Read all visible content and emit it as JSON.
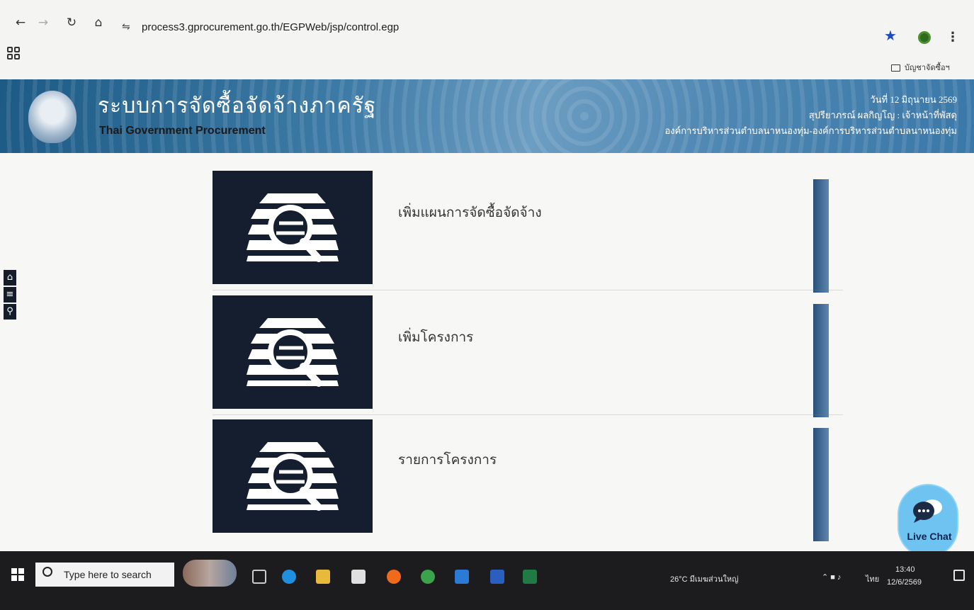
{
  "browser": {
    "url": "process3.gprocurement.go.th/EGPWeb/jsp/control.egp",
    "bookmark_folder": "บัญชาจัดซื้อฯ",
    "back_icon": "back-arrow-icon",
    "forward_icon": "forward-arrow-icon",
    "reload_icon": "reload-icon",
    "home_icon": "home-icon"
  },
  "header": {
    "title_th": "ระบบการจัดซื้อจัดจ้างภาครัฐ",
    "title_en": "Thai Government Procurement",
    "date": "วันที่ 12 มิถุนายน 2569",
    "user": "สุปรียาภรณ์ ผลกิญโญ : เจ้าหน้าที่พัสดุ",
    "agency": "องค์การบริหารส่วนตำบลนาหนองทุ่ม-องค์การบริหารส่วนตำบลนาหนองทุ่ม"
  },
  "side_tools": {
    "home_icon": "home-icon",
    "menu_icon": "menu-icon",
    "search_icon": "search-icon"
  },
  "menu": {
    "items": [
      {
        "label": "เพิ่มแผนการจัดซื้อจัดจ้าง",
        "icon": "document-search-icon"
      },
      {
        "label": "เพิ่มโครงการ",
        "icon": "document-search-icon"
      },
      {
        "label": "รายการโครงการ",
        "icon": "document-search-icon"
      }
    ]
  },
  "live_chat": {
    "label": "Live Chat"
  },
  "taskbar": {
    "search_placeholder": "Type here to search",
    "weather": "26°C มีเมฆส่วนใหญ่",
    "language": "ไทย",
    "time": "13:40",
    "date": "12/6/2569"
  }
}
